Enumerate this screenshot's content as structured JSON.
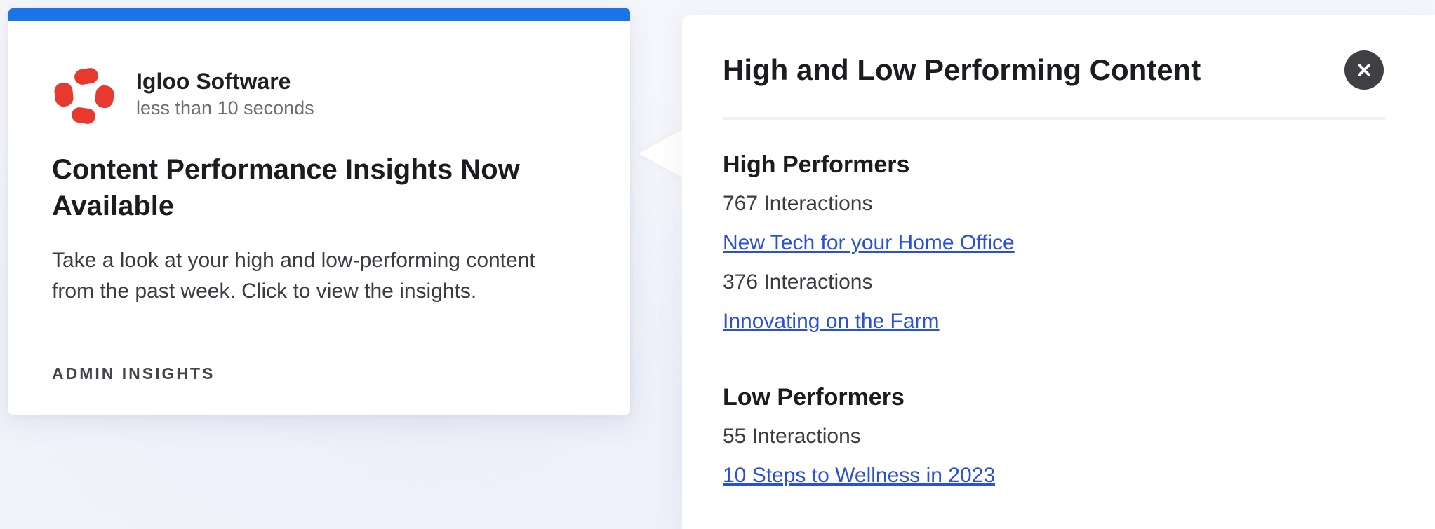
{
  "notification": {
    "sender": "Igloo Software",
    "time": "less than 10 seconds",
    "title": "Content Performance Insights Now Available",
    "body": "Take a look at your high and low-performing content from the past week. Click to view the insights.",
    "tag": "ADMIN INSIGHTS",
    "accent_color": "#1a73e8",
    "logo_color": "#e8392f",
    "logo_icon": "igloo-logo-icon"
  },
  "panel": {
    "title": "High and Low Performing Content",
    "close_icon": "close-icon",
    "high": {
      "heading": "High Performers",
      "items": [
        {
          "interactions": "767 Interactions",
          "link": "New Tech for your Home Office"
        },
        {
          "interactions": "376 Interactions",
          "link": "Innovating on the Farm"
        }
      ]
    },
    "low": {
      "heading": "Low Performers",
      "items": [
        {
          "interactions": "55 Interactions",
          "link": "10 Steps to Wellness in 2023"
        }
      ]
    },
    "link_color": "#2a50d8"
  }
}
